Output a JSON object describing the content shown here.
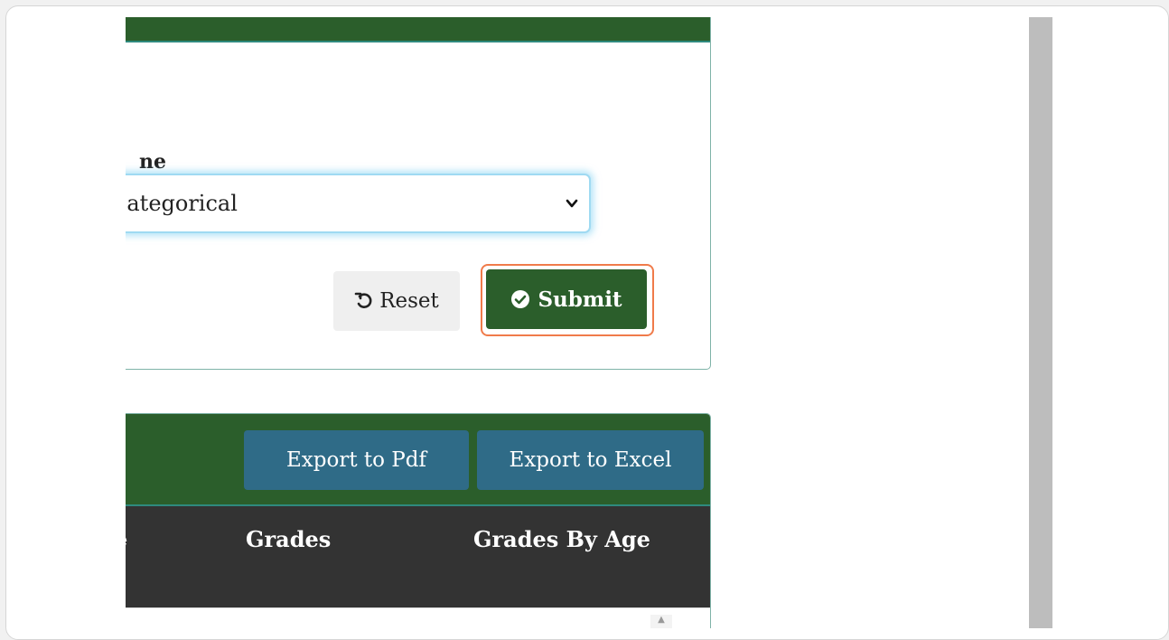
{
  "form": {
    "field_label": "ne",
    "select_value": "Categorical",
    "reset_label": "Reset",
    "submit_label": "Submit"
  },
  "report": {
    "export_pdf_label": "Export to Pdf",
    "export_excel_label": "Export to Excel",
    "columns": [
      "e",
      "Grades",
      "Grades By Age"
    ]
  },
  "colors": {
    "header_green": "#2b5e2b",
    "export_blue": "#2f6b87",
    "table_header_dark": "#333333",
    "highlight_orange": "#f07b4a",
    "focus_blue": "#9fdaf2"
  },
  "icons": {
    "reset": "undo-icon",
    "submit": "check-circle-icon",
    "select": "chevron-down-icon"
  }
}
